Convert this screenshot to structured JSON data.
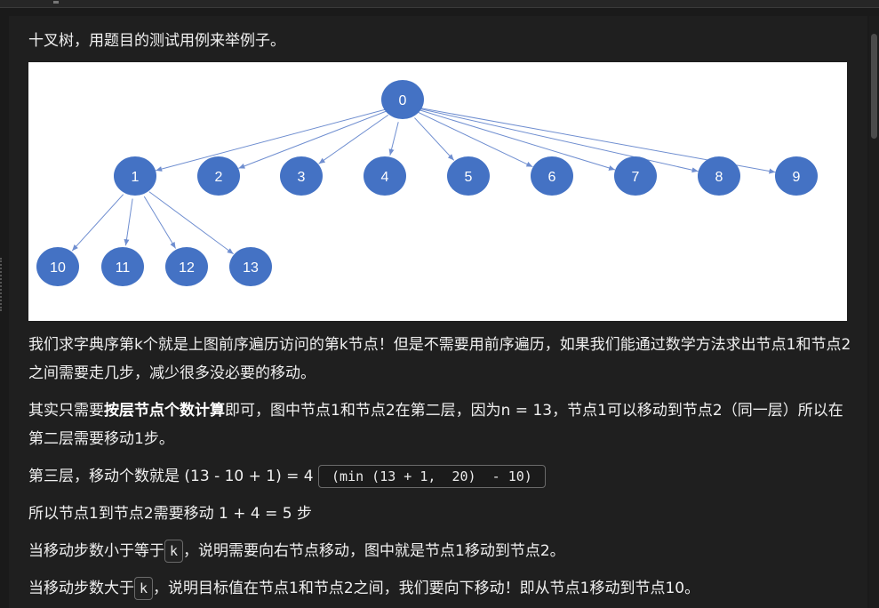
{
  "intro": "十叉树，用题目的测试用例来举例子。",
  "tree": {
    "root": "0",
    "level2": [
      "1",
      "2",
      "3",
      "4",
      "5",
      "6",
      "7",
      "8",
      "9"
    ],
    "level3": [
      "10",
      "11",
      "12",
      "13"
    ],
    "node_color": "#4472c4",
    "edge_color": "#6f8ed0"
  },
  "para1": "我们求字典序第k个就是上图前序遍历访问的第k节点！但是不需要用前序遍历，如果我们能通过数学方法求出节点1和节点2之间需要走几步，减少很多没必要的移动。",
  "para2": {
    "before": "其实只需要",
    "bold": "按层节点个数计算",
    "after": "即可，图中节点1和节点2在第二层，因为n = 13，节点1可以移动到节点2（同一层）所以在第二层需要移动1步。"
  },
  "para3": {
    "text": "第三层，移动个数就是 (13 - 10 + 1) = 4",
    "code": "(min (13 + 1,  20)  - 10)"
  },
  "para4": "所以节点1到节点2需要移动 1 + 4 = 5 步",
  "para5": {
    "before": "当移动步数小于等于",
    "code": "k",
    "after": "，说明需要向右节点移动，图中就是节点1移动到节点2。"
  },
  "para6": {
    "before": "当移动步数大于",
    "code": "k",
    "after": "，说明目标值在节点1和节点2之间，我们要向下移动！即从节点1移动到节点10。"
  }
}
